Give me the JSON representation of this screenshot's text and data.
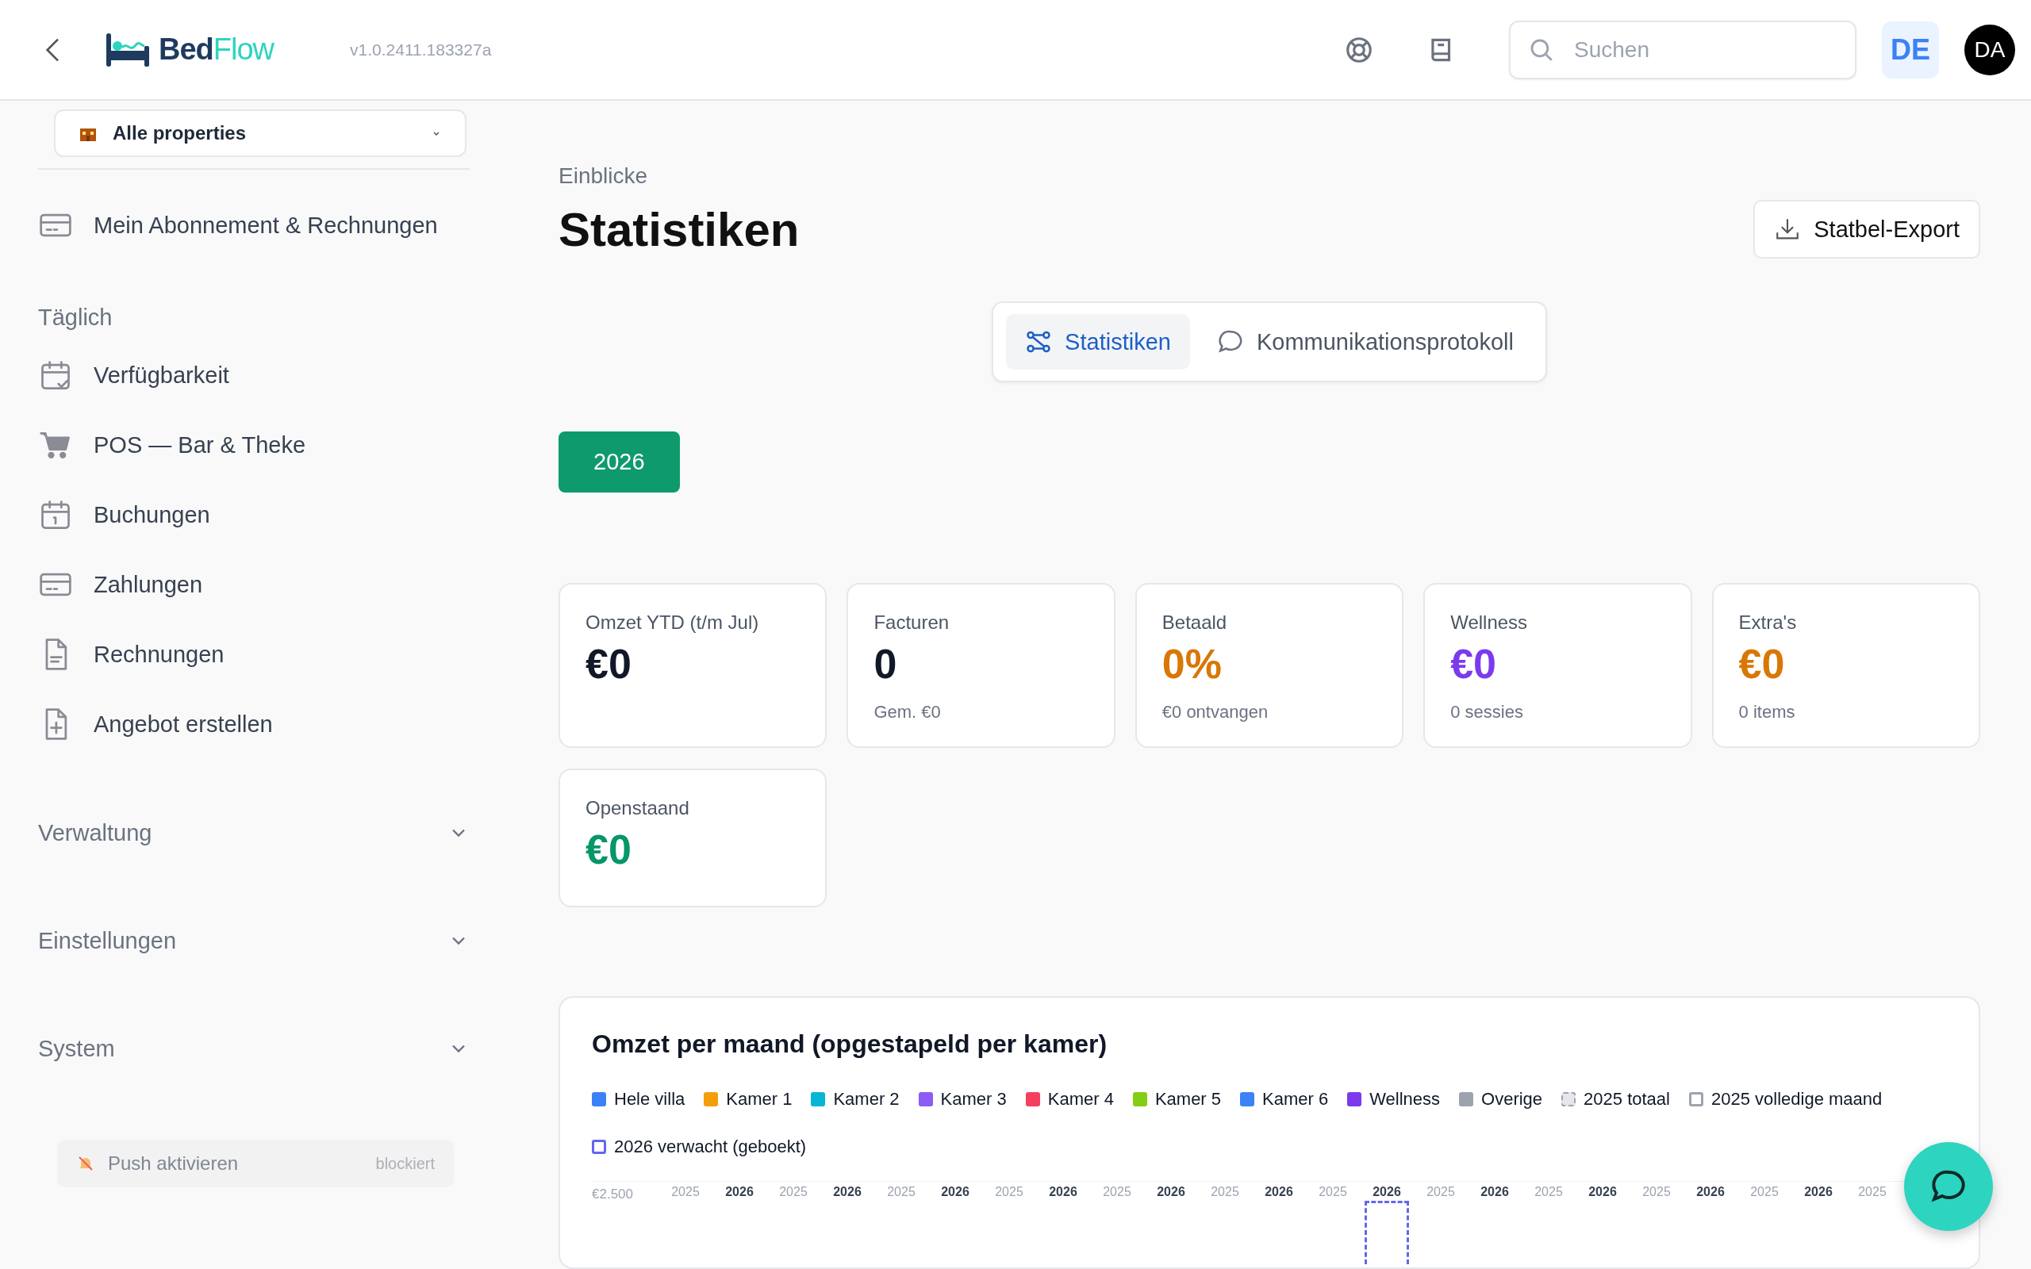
{
  "header": {
    "logo": {
      "part_1": "Bed",
      "part_2": "Flow"
    },
    "version": "v1.0.2411.183327a",
    "search": {
      "placeholder": "Suchen"
    },
    "language": "DE",
    "avatar": "DA"
  },
  "sidebar": {
    "property_select": "Alle properties",
    "account_item": "Mein Abonnement & Rechnungen",
    "sections": [
      {
        "title": "Täglich",
        "kind": "list",
        "items": [
          {
            "label": "Verfügbarkeit"
          },
          {
            "label": "POS — Bar & Theke"
          },
          {
            "label": "Buchungen"
          },
          {
            "label": "Zahlungen"
          },
          {
            "label": "Rechnungen"
          },
          {
            "label": "Angebot erstellen"
          }
        ]
      },
      {
        "title": "Verwaltung",
        "kind": "group",
        "expanded": false
      },
      {
        "title": "Einstellungen",
        "kind": "group",
        "expanded": false
      },
      {
        "title": "System",
        "kind": "group",
        "expanded": false
      }
    ],
    "push": {
      "label": "Push aktivieren",
      "status": "blockiert",
      "disabled": true
    }
  },
  "page": {
    "breadcrumb": "Einblicke",
    "title": "Statistiken",
    "export_button": "Statbel-Export"
  },
  "tabs": [
    {
      "label": "Statistiken",
      "selected": true
    },
    {
      "label": "Kommunikationsprotokoll",
      "selected": false
    }
  ],
  "years": [
    {
      "label": "2026",
      "selected": true
    }
  ],
  "cards": [
    {
      "label": "Omzet YTD (t/m Jul)",
      "value": "€0",
      "color": "#111827"
    },
    {
      "label": "Facturen",
      "value": "0",
      "sub": "Gem. €0",
      "color": "#111827"
    },
    {
      "label": "Betaald",
      "value": "0%",
      "sub": "€0 ontvangen",
      "color": "#d97706"
    },
    {
      "label": "Wellness",
      "value": "€0",
      "sub": "0 sessies",
      "color": "#7c3aed"
    },
    {
      "label": "Extra's",
      "value": "€0",
      "sub": "0 items",
      "color": "#d97706"
    },
    {
      "label": "Openstaand",
      "value": "€0",
      "color": "#059669"
    }
  ],
  "chart": {
    "title": "Omzet per maand (opgestapeld per kamer)",
    "legend": [
      {
        "label": "Hele villa",
        "color": "#3b82f6",
        "kind": "solid"
      },
      {
        "label": "Kamer 1",
        "color": "#f59e0b",
        "kind": "solid"
      },
      {
        "label": "Kamer 2",
        "color": "#06b6d4",
        "kind": "solid"
      },
      {
        "label": "Kamer 3",
        "color": "#8b5cf6",
        "kind": "solid"
      },
      {
        "label": "Kamer 4",
        "color": "#f43f5e",
        "kind": "solid"
      },
      {
        "label": "Kamer 5",
        "color": "#84cc16",
        "kind": "solid"
      },
      {
        "label": "Kamer 6",
        "color": "#3b82f6",
        "kind": "solid"
      },
      {
        "label": "Wellness",
        "color": "#7c3aed",
        "kind": "solid"
      },
      {
        "label": "Overige",
        "color": "#9ca3af",
        "kind": "solid"
      },
      {
        "label": "2025 totaal",
        "color": "#9ca3af",
        "kind": "dashed"
      },
      {
        "label": "2025 volledige maand",
        "color": "#9ca3af",
        "kind": "outline"
      },
      {
        "label": "2026 verwacht (geboekt)",
        "color": "#6366f1",
        "kind": "outline"
      }
    ],
    "y_label": "€2.500",
    "columns": [
      {
        "label": "2025",
        "kind": "previous"
      },
      {
        "label": "2026",
        "kind": "current"
      },
      {
        "label": "2025",
        "kind": "previous"
      },
      {
        "label": "2026",
        "kind": "current"
      },
      {
        "label": "2025",
        "kind": "previous"
      },
      {
        "label": "2026",
        "kind": "current"
      },
      {
        "label": "2025",
        "kind": "previous"
      },
      {
        "label": "2026",
        "kind": "current"
      },
      {
        "label": "2025",
        "kind": "previous"
      },
      {
        "label": "2026",
        "kind": "current"
      },
      {
        "label": "2025",
        "kind": "previous"
      },
      {
        "label": "2026",
        "kind": "current"
      },
      {
        "label": "2025",
        "kind": "previous"
      },
      {
        "label": "2026",
        "kind": "current",
        "expected": true
      },
      {
        "label": "2025",
        "kind": "previous"
      },
      {
        "label": "2026",
        "kind": "current"
      },
      {
        "label": "2025",
        "kind": "previous"
      },
      {
        "label": "2026",
        "kind": "current"
      },
      {
        "label": "2025",
        "kind": "previous"
      },
      {
        "label": "2026",
        "kind": "current"
      },
      {
        "label": "2025",
        "kind": "previous"
      },
      {
        "label": "2026",
        "kind": "current"
      },
      {
        "label": "2025",
        "kind": "previous"
      }
    ]
  }
}
